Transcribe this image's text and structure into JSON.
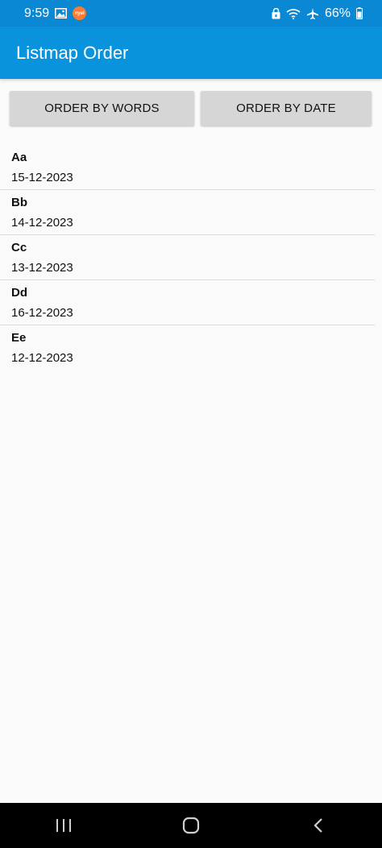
{
  "status_bar": {
    "time": "9:59",
    "badge_text": "nyel",
    "battery": "66%"
  },
  "app_bar": {
    "title": "Listmap Order"
  },
  "buttons": {
    "order_words": "ORDER BY WORDS",
    "order_date": "ORDER BY DATE"
  },
  "items": [
    {
      "title": "Aa",
      "date": "15-12-2023"
    },
    {
      "title": "Bb",
      "date": "14-12-2023"
    },
    {
      "title": "Cc",
      "date": "13-12-2023"
    },
    {
      "title": "Dd",
      "date": "16-12-2023"
    },
    {
      "title": "Ee",
      "date": "12-12-2023"
    }
  ],
  "colors": {
    "status_bar": "#0a88d4",
    "app_bar": "#0a93dd",
    "button": "#d6d6d6",
    "background": "#fafafa",
    "nav_bar": "#000000"
  },
  "icons": {
    "status_left": [
      "image-icon",
      "app-notification-icon"
    ],
    "status_right": [
      "lock-icon",
      "wifi-icon",
      "airplane-icon",
      "battery-icon"
    ],
    "nav": [
      "recents-icon",
      "home-icon",
      "back-icon"
    ]
  }
}
